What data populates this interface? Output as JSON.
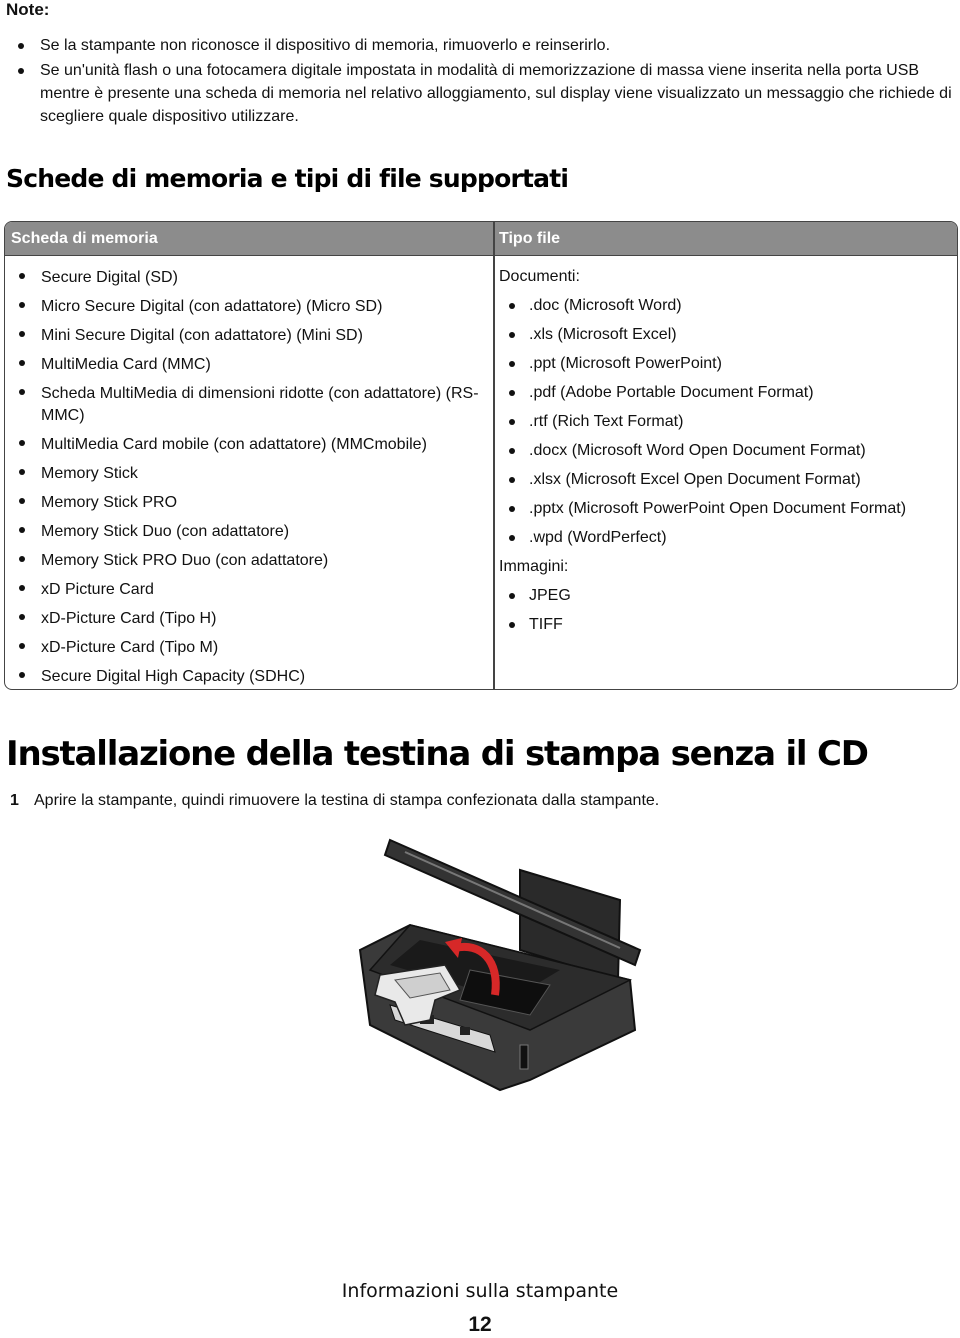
{
  "note": {
    "title": "Note:",
    "items": [
      "Se la stampante non riconosce il dispositivo di memoria, rimuoverlo e reinserirlo.",
      "Se un'unità flash o una fotocamera digitale impostata in modalità di memorizzazione di massa viene inserita nella porta USB mentre è presente una scheda di memoria nel relativo alloggiamento, sul display viene visualizzato un messaggio che richiede di scegliere quale dispositivo utilizzare."
    ]
  },
  "section1": {
    "title": "Schede di memoria e tipi di file supportati",
    "table": {
      "headers": [
        "Scheda di memoria",
        "Tipo file"
      ],
      "memory_cards": [
        "Secure Digital (SD)",
        "Micro Secure Digital (con adattatore) (Micro SD)",
        "Mini Secure Digital (con adattatore) (Mini SD)",
        "MultiMedia Card (MMC)",
        "Scheda MultiMedia di dimensioni ridotte (con adattatore) (RS-MMC)",
        "MultiMedia Card mobile (con adattatore) (MMCmobile)",
        "Memory Stick",
        "Memory Stick PRO",
        "Memory Stick Duo (con adattatore)",
        "Memory Stick PRO Duo (con adattatore)",
        "xD Picture Card",
        "xD-Picture Card (Tipo H)",
        "xD-Picture Card (Tipo M)",
        "Secure Digital High Capacity (SDHC)"
      ],
      "file_types": {
        "documents_label": "Documenti:",
        "documents": [
          ".doc (Microsoft Word)",
          ".xls (Microsoft Excel)",
          ".ppt (Microsoft PowerPoint)",
          ".pdf (Adobe Portable Document Format)",
          ".rtf (Rich Text Format)",
          ".docx (Microsoft Word Open Document Format)",
          ".xlsx (Microsoft Excel Open Document Format)",
          ".pptx (Microsoft PowerPoint Open Document Format)",
          ".wpd (WordPerfect)"
        ],
        "images_label": "Immagini:",
        "images": [
          "JPEG",
          "TIFF"
        ]
      }
    },
    "colors": {
      "header_bg": "#8c8c8c",
      "header_text": "#ffffff",
      "border": "#444444"
    }
  },
  "section2": {
    "title": "Installazione della testina di stampa senza il CD",
    "steps": [
      {
        "number": "1",
        "text": "Aprire la stampante, quindi rimuovere la testina di stampa confezionata dalla stampante."
      }
    ],
    "figure": {
      "icon": "printer-printhead-illustration",
      "arrow_color": "#d62828"
    }
  },
  "footer": {
    "title": "Informazioni sulla stampante",
    "page_number": "12"
  }
}
